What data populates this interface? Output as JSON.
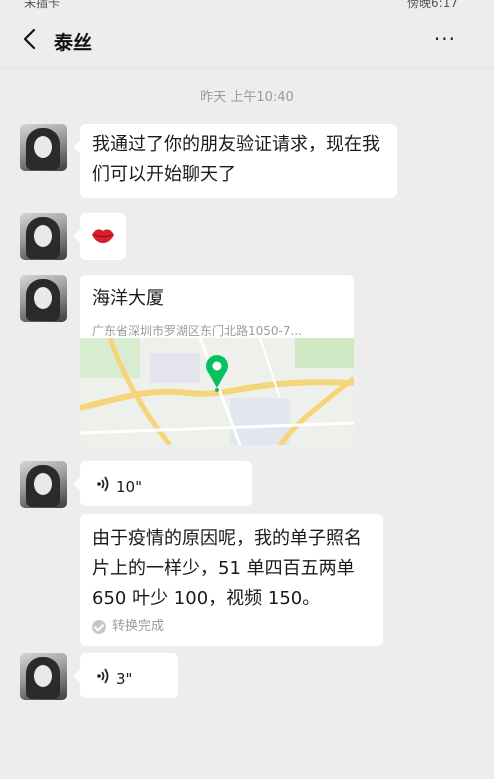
{
  "status_bar": {
    "left_text": "未插卡",
    "right_text": "傍晚6:17"
  },
  "header": {
    "title": "泰丝",
    "more_label": "···"
  },
  "timestamp": "昨天 上午10:40",
  "messages": {
    "m1_text": "我通过了你的朋友验证请求，现在我们可以开始聊天了",
    "m2_emoji": "lips-icon",
    "m3": {
      "name": "海洋大厦",
      "address": "广东省深圳市罗湖区东门北路1050-7..."
    },
    "m4_duration": "10\"",
    "m5": {
      "text": "由于疫情的原因呢，我的单子照名片上的一样少，51 单四百五两单 650 叶少 100，视频 150。",
      "converted_label": "转换完成"
    },
    "m6_duration": "3\""
  }
}
